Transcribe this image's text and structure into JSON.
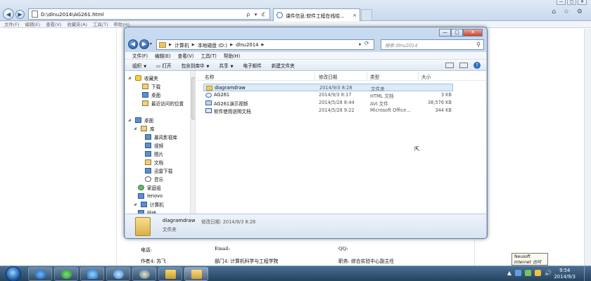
{
  "browser": {
    "address": "D:\\dlnu2014\\AG261.html",
    "tab_title": "课件信息:软件工程在线绘...",
    "tab_close": "×",
    "menu": [
      "文件(F)",
      "编辑(E)",
      "查看(V)",
      "收藏夹(A)",
      "工具(T)",
      "帮助(H)"
    ],
    "address_tools": "ρ ▾ ℭ",
    "right_tools": "⌂ ☆ ⚙",
    "window_controls": [
      "—",
      "▢",
      "✕"
    ]
  },
  "document": {
    "phone_label": "电话:",
    "email_label": "Email:",
    "qq_label": "QQ:",
    "author_label": "作者4: 苏飞",
    "dept_label": "部门4: 计算机科学与工程学院",
    "position_label": "职务: 综合实验中心副主任"
  },
  "explorer": {
    "caption_buttons": [
      "—",
      "▢",
      "✕"
    ],
    "breadcrumb": [
      "计算机",
      "本地磁盘 (D:)",
      "dlnu2014"
    ],
    "search_placeholder": "搜索 dlnu2014",
    "menu": [
      "文件(F)",
      "编辑(E)",
      "查看(V)",
      "工具(T)",
      "帮助(H)"
    ],
    "toolbar": {
      "organize": "组织",
      "open": "打开",
      "include_library": "包含到库中",
      "share": "共享",
      "email": "电子邮件",
      "new_folder": "新建文件夹",
      "help": "?"
    },
    "nav": {
      "favorites": "收藏夹",
      "downloads": "下载",
      "desktop_fav": "桌面",
      "recent": "最近访问的位置",
      "desktop": "桌面",
      "libraries": "库",
      "storm": "暴风影视库",
      "videos": "视频",
      "pictures": "图片",
      "documents": "文档",
      "thunder": "迅雷下载",
      "music": "音乐",
      "homegroup": "家庭组",
      "lenovo": "lenovo",
      "computer": "计算机",
      "network": "网络"
    },
    "columns": {
      "name": "名称",
      "modified": "修改日期",
      "type": "类型",
      "size": "大小"
    },
    "files": [
      {
        "name": "diagramdraw",
        "modified": "2014/9/3 8:28",
        "type": "文件夹",
        "size": ""
      },
      {
        "name": "AG261",
        "modified": "2014/9/3 8:17",
        "type": "HTML 文档",
        "size": "3 KB"
      },
      {
        "name": "AG261演示视频",
        "modified": "2014/5/28 8:44",
        "type": "AVI 文件",
        "size": "38,576 KB"
      },
      {
        "name": "软件使用说明文档",
        "modified": "2014/5/28 9:22",
        "type": "Microsoft Office...",
        "size": "344 KB"
      }
    ],
    "status": {
      "name": "diagramdraw",
      "modified": "修改日期: 2014/9/3 8:28",
      "type": "文件夹"
    }
  },
  "popup": {
    "line1": "Neusoft",
    "line2": "Internet 访问"
  },
  "taskbar": {
    "clock_time": "9:54",
    "clock_date": "2014/9/3",
    "tray_arrow": "▲",
    "tray_volume": "🔊"
  },
  "colors": {
    "selection": "#dceaf9",
    "taskbar": "#24435f",
    "explorer_frame": "#b7cbe6"
  }
}
